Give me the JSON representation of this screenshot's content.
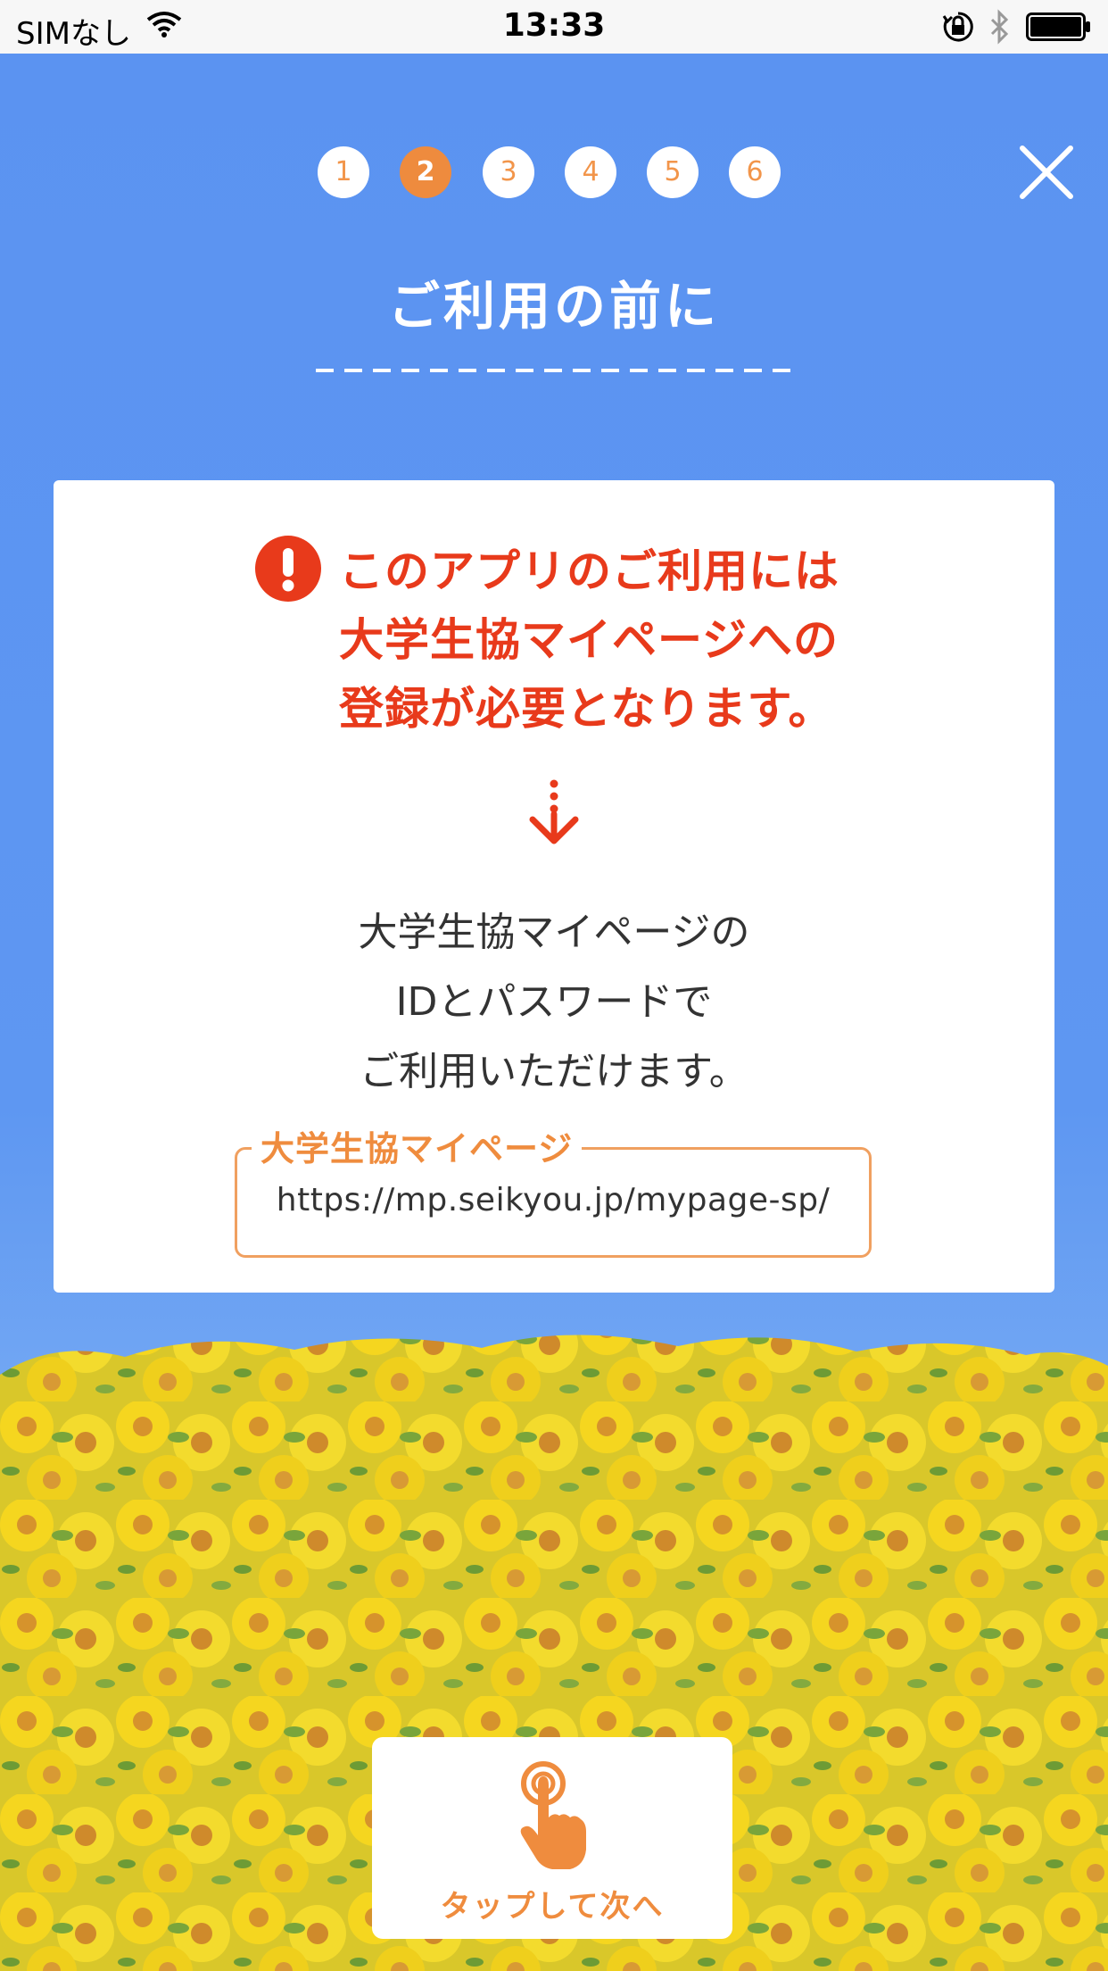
{
  "status_bar": {
    "carrier": "SIMなし",
    "time": "13:33"
  },
  "steps": [
    "1",
    "2",
    "3",
    "4",
    "5",
    "6"
  ],
  "active_step": "2",
  "title": "ご利用の前に",
  "card": {
    "warning_lines": [
      "このアプリのご利用には",
      "大学生協マイページへの",
      "登録が必要となります。"
    ],
    "info_lines": [
      "大学生協マイページの",
      "IDとパスワードで",
      "ご利用いただけます。"
    ],
    "link_label": "大学生協マイページ",
    "link_url": "https://mp.seikyou.jp/mypage-sp/"
  },
  "next_button": {
    "label": "タップして次へ"
  },
  "colors": {
    "sky": "#5b93f1",
    "accent": "#ef8c3e",
    "warning": "#e83a1b"
  },
  "icons": [
    "wifi-icon",
    "orientation-lock-icon",
    "bluetooth-icon",
    "battery-icon",
    "close-icon",
    "warning-icon",
    "arrow-down-icon",
    "tap-finger-icon"
  ]
}
